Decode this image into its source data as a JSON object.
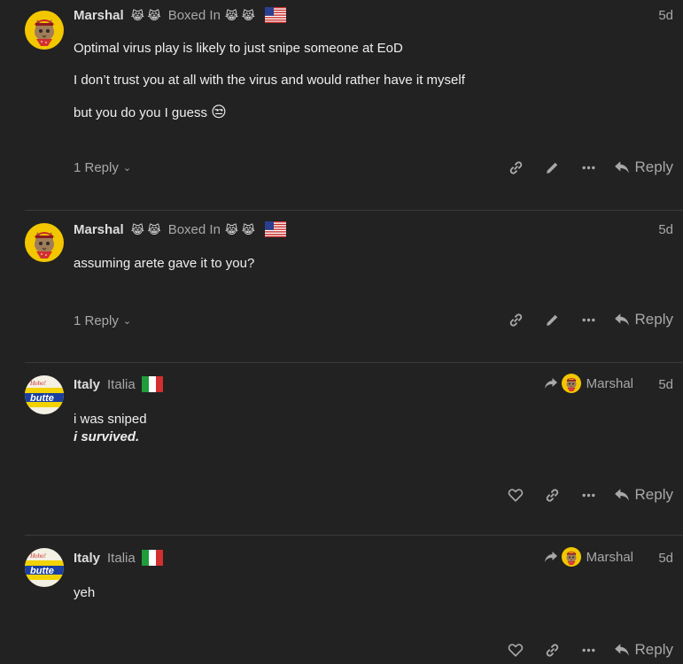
{
  "posts": [
    {
      "username": "Marshal",
      "title_emoji_before": "😹 😹",
      "title": "Boxed In",
      "title_emoji_after": "😹 😹",
      "flag": "us-flag",
      "date": "5d",
      "paragraphs": [
        "Optimal virus play is likely to just snipe someone at EoD",
        "I don’t trust you at all with the virus and would rather have it myself",
        "but you do you I guess"
      ],
      "trailing_emoji": "😒",
      "replies_label": "1 Reply",
      "reply_label": "Reply"
    },
    {
      "username": "Marshal",
      "title_emoji_before": "😹 😹",
      "title": "Boxed In",
      "title_emoji_after": "😹 😹",
      "flag": "us-flag",
      "date": "5d",
      "paragraphs": [
        "assuming arete gave it to you?"
      ],
      "replies_label": "1 Reply",
      "reply_label": "Reply"
    },
    {
      "username": "Italy",
      "title": "Italia",
      "flag": "italy-flag",
      "reply_to": "Marshal",
      "date": "5d",
      "line1": "i was sniped",
      "line2": "i survived.",
      "reply_label": "Reply"
    },
    {
      "username": "Italy",
      "title": "Italia",
      "flag": "italy-flag",
      "reply_to": "Marshal",
      "date": "5d",
      "paragraphs": [
        "yeh"
      ],
      "reply_label": "Reply"
    }
  ]
}
